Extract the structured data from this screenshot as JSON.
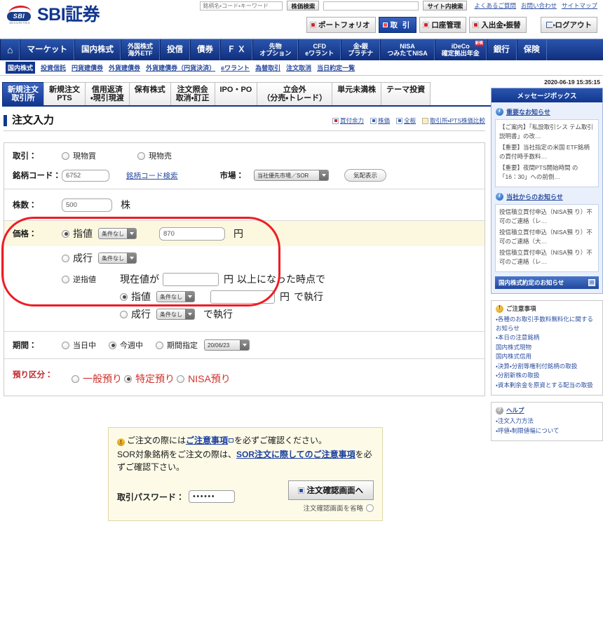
{
  "header": {
    "brand": "SBI証券",
    "logo_mark": "SBI",
    "logo_sub": "SECURITIES",
    "search_placeholder": "銘柄名・コード・キーワード",
    "search_button": "株価検索",
    "site_search_value": "",
    "site_search_button": "サイト内検索",
    "links": [
      "よくあるご質問",
      "お問い合わせ",
      "サイトマップ"
    ],
    "account_buttons": [
      {
        "label": "ポートフォリオ",
        "active": false
      },
      {
        "label": "取 引",
        "active": true
      },
      {
        "label": "口座管理",
        "active": false
      },
      {
        "label": "入出金・振替",
        "active": false
      }
    ],
    "logout_label": "ログアウト"
  },
  "global_nav": [
    {
      "line1": "⌂",
      "line2": "",
      "home": true
    },
    {
      "line1": "マーケット",
      "line2": ""
    },
    {
      "line1": "国内株式",
      "line2": ""
    },
    {
      "line1": "外国株式",
      "line2": "海外ETF",
      "small": true
    },
    {
      "line1": "投信",
      "line2": ""
    },
    {
      "line1": "債券",
      "line2": ""
    },
    {
      "line1": "Ｆ Ｘ",
      "line2": ""
    },
    {
      "line1": "先物",
      "line2": "オプション",
      "small": true
    },
    {
      "line1": "CFD",
      "line2": "eワラント",
      "small": true
    },
    {
      "line1": "金・銀",
      "line2": "プラチナ",
      "small": true
    },
    {
      "line1": "NISA",
      "line2": "つみたてNISA",
      "small": true
    },
    {
      "line1": "iDeCo",
      "line2": "確定拠出年金",
      "small": true,
      "badge": "新規"
    },
    {
      "line1": "銀行",
      "line2": ""
    },
    {
      "line1": "保険",
      "line2": ""
    }
  ],
  "sub_nav": {
    "selected": "国内株式",
    "links": [
      "投資信託",
      "円貨建債券",
      "外貨建債券",
      "外貨建債券（円貨決済）",
      "eワラント",
      "為替取引",
      "注文取消",
      "当日約定一覧"
    ]
  },
  "tabs": [
    {
      "line1": "新規注文",
      "line2": "取引所",
      "active": true
    },
    {
      "line1": "新規注文",
      "line2": "PTS",
      "active": false
    },
    {
      "line1": "信用返済",
      "line2": "・現引現渡",
      "active": false
    },
    {
      "line1": "保有株式",
      "line2": "",
      "active": false
    },
    {
      "line1": "注文照会",
      "line2": "取消・訂正",
      "active": false
    },
    {
      "line1": "IPO・PO",
      "line2": "",
      "active": false
    },
    {
      "line1": "立会外",
      "line2": "（分売・トレード）",
      "active": false
    },
    {
      "line1": "単元未満株",
      "line2": "",
      "active": false
    },
    {
      "line1": "テーマ投資",
      "line2": "",
      "active": false
    }
  ],
  "page": {
    "title": "注文入力",
    "title_links": [
      {
        "label": "買付余力",
        "icon": "red-doc-icon"
      },
      {
        "label": "株価",
        "icon": "blue-doc-icon"
      },
      {
        "label": "全板",
        "icon": "blue-doc-icon"
      },
      {
        "label": "取引所・PTS株価比較",
        "icon": "yellow-doc-icon"
      }
    ]
  },
  "form": {
    "trade": {
      "label": "取引：",
      "options": [
        {
          "label": "現物買",
          "selected": false
        },
        {
          "label": "現物売",
          "selected": false
        }
      ]
    },
    "stock_code": {
      "label": "銘柄コード：",
      "value": "6752",
      "search_link": "銘柄コード検索"
    },
    "market": {
      "label": "市場：",
      "selected": "当社優先市場／SOR",
      "quote_button": "気配表示"
    },
    "quantity": {
      "label": "株数：",
      "value": "500",
      "unit": "株"
    },
    "price": {
      "label": "価格：",
      "limit": {
        "label": "指値",
        "selected": true,
        "condition": "条件なし",
        "value": "870",
        "unit": "円"
      },
      "market_order": {
        "label": "成行",
        "selected": false,
        "condition": "条件なし"
      },
      "stop": {
        "label": "逆指値",
        "selected": false,
        "prefix": "現在値が",
        "trigger_value": "",
        "trigger_unit": "円",
        "suffix": "以上になった時点で",
        "limit": {
          "label": "指値",
          "selected": true,
          "condition": "条件なし",
          "value": "",
          "unit": "円",
          "tail": "で執行"
        },
        "market": {
          "label": "成行",
          "selected": false,
          "condition": "条件なし",
          "tail": "で執行"
        }
      }
    },
    "period": {
      "label": "期間：",
      "options": [
        {
          "label": "当日中",
          "selected": false
        },
        {
          "label": "今週中",
          "selected": true
        },
        {
          "label": "期間指定",
          "selected": false
        }
      ],
      "date_value": "20/06/23"
    },
    "deposit": {
      "label": "預り区分：",
      "options": [
        {
          "label": "一般預り",
          "selected": false
        },
        {
          "label": "特定預り",
          "selected": true
        },
        {
          "label": "NISA預り",
          "selected": false
        }
      ]
    }
  },
  "notice": {
    "line1_pre": "ご注文の際には",
    "line1_link": "ご注意事項",
    "line1_post": "を必ずご確認ください。",
    "line2_pre": "SOR対象銘柄をご注文の際は、",
    "line2_link": "SOR注文に際してのご注意事項",
    "line2_post": "を必ずご確認下さい。",
    "password_label": "取引パスワード：",
    "password_value": "••••••",
    "confirm_button": "注文確認画面へ",
    "skip_label": "注文確認画面を省略"
  },
  "sidebar": {
    "timestamp": "2020-06-19 15:35:15",
    "message_box": {
      "title": "メッセージボックス",
      "groups": [
        {
          "heading": "重要なお知らせ",
          "items": [
            "【ご案内】「私設取引シス テム取引説明書」の改…",
            "【重要】当社指定の米国 ETF銘柄の買付時手数料…",
            "【重要】夜間PTS開始時間 の「16：30」への前倒…"
          ]
        },
        {
          "heading": "当社からのお知らせ",
          "items": [
            "投信積立買付申込（NISA預 り）不可のご連絡（レ…",
            "投信積立買付申込（NISA預 り）不可のご連絡（大…",
            "投信積立買付申込（NISA預 り）不可のご連絡（レ…"
          ]
        }
      ],
      "footer_bar": "国内株式約定のお知らせ"
    },
    "caution": {
      "heading": "ご注意事項",
      "items": [
        "・各種のお取引手数料無料化に関するお知らせ",
        "・本日の注意銘柄",
        "国内株式現物",
        "国内株式信用",
        "・決算・分割等権利付銘柄の取扱",
        "・分割新株の取扱",
        "・資本剰余金を原資とする配当の取扱"
      ]
    },
    "help": {
      "heading": "ヘルプ",
      "items": [
        "・注文入力方法",
        "・呼値・制限値幅について"
      ]
    }
  }
}
